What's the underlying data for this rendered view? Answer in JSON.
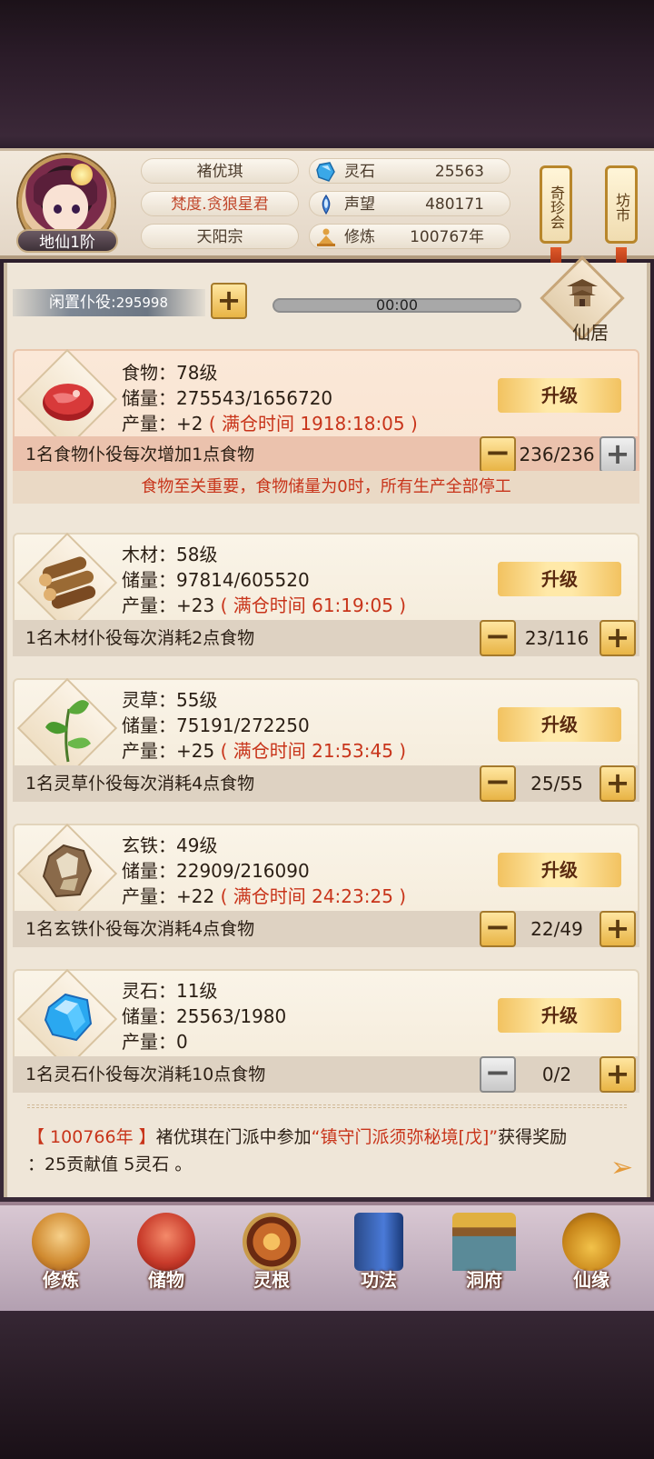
{
  "player": {
    "name": "褚优琪",
    "title": "梵度.贪狼星君",
    "sect": "天阳宗",
    "rank": "地仙1阶"
  },
  "resources": [
    {
      "label": "灵石",
      "value": "25563",
      "icon": "spirit-stone-icon",
      "color": "#3aa8e8"
    },
    {
      "label": "声望",
      "value": "480171",
      "icon": "reputation-icon",
      "color": "#4a8ad8"
    },
    {
      "label": "修炼",
      "value": "100767年",
      "icon": "meditation-icon",
      "color": "#e0a040"
    }
  ],
  "side_buttons": {
    "treasure": "奇珍会",
    "market": "坊市"
  },
  "idle": {
    "label": "闲置仆役",
    "value": "295998",
    "timer": "00:00"
  },
  "residence_label": "仙居",
  "upgrade_label": "升级",
  "items": [
    {
      "name_line": "食物：78级",
      "storage": "储量：275543/1656720",
      "output": "产量：+2",
      "full": "( 满仓时间 1918:18:05 )",
      "worker_text": "1名食物仆役每次增加1点食物",
      "count": "236/236",
      "icon": "meat-icon"
    },
    {
      "name_line": "木材：58级",
      "storage": "储量：97814/605520",
      "output": "产量：+23",
      "full": "( 满仓时间 61:19:05 )",
      "worker_text": "1名木材仆役每次消耗2点食物",
      "count": "23/116",
      "icon": "wood-logs-icon"
    },
    {
      "name_line": "灵草：55级",
      "storage": "储量：75191/272250",
      "output": "产量：+25",
      "full": "( 满仓时间 21:53:45 )",
      "worker_text": "1名灵草仆役每次消耗4点食物",
      "count": "25/55",
      "icon": "herb-icon"
    },
    {
      "name_line": "玄铁：49级",
      "storage": "储量：22909/216090",
      "output": "产量：+22",
      "full": "( 满仓时间 24:23:25 )",
      "worker_text": "1名玄铁仆役每次消耗4点食物",
      "count": "22/49",
      "icon": "iron-ore-icon"
    },
    {
      "name_line": "灵石：11级",
      "storage": "储量：25563/1980",
      "output": "产量：0",
      "full": "",
      "worker_text": "1名灵石仆役每次消耗10点食物",
      "count": "0/2",
      "icon": "spirit-crystal-icon"
    }
  ],
  "notice": "食物至关重要，食物储量为0时，所有生产全部停工",
  "log": {
    "year": "【 100766年 】",
    "text1": "褚优琪在门派中参加",
    "event": "“镇守门派须弥秘境[戊]”",
    "text2": "获得奖励",
    "reward": "：25贡献值 5灵石 。"
  },
  "nav": [
    {
      "label": "修炼",
      "icon": "cultivate-icon",
      "color": "#e0a050"
    },
    {
      "label": "储物",
      "icon": "storage-bag-icon",
      "color": "#d04a3a"
    },
    {
      "label": "灵根",
      "icon": "spirit-root-icon",
      "color": "#c86a2a"
    },
    {
      "label": "功法",
      "icon": "skill-book-icon",
      "color": "#3a6ab8"
    },
    {
      "label": "洞府",
      "icon": "cave-abode-icon",
      "color": "#b87a3a"
    },
    {
      "label": "仙缘",
      "icon": "fate-gourd-icon",
      "color": "#e0b040"
    }
  ]
}
